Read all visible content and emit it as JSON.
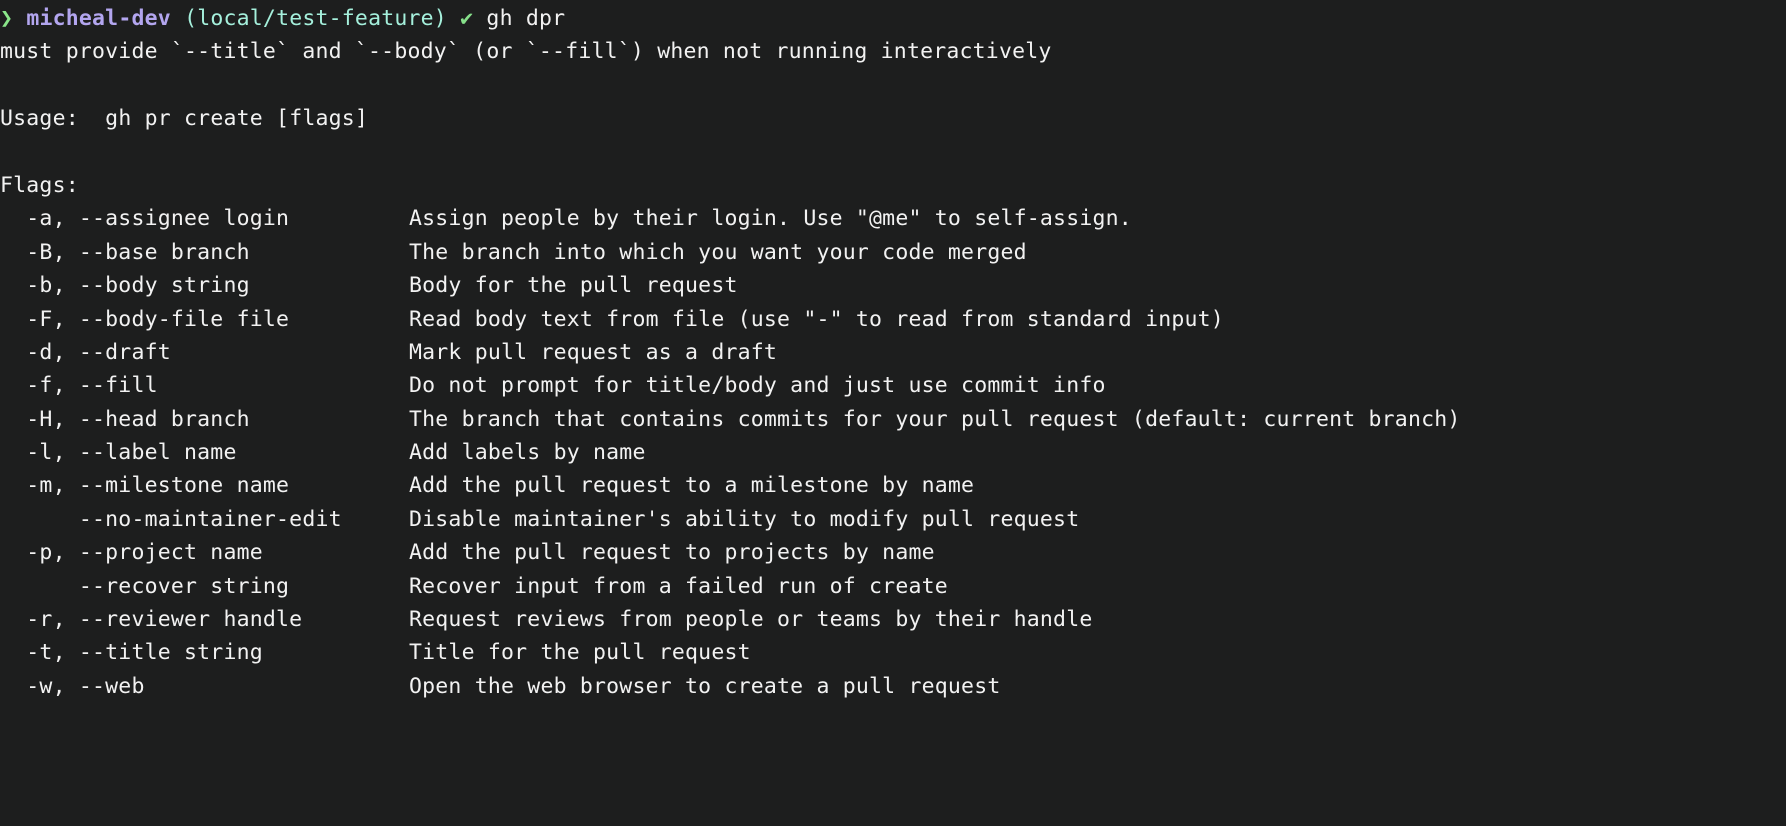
{
  "terminal": {
    "background_color": "#1d1e1e",
    "foreground_color": "#f2f2f2",
    "prompt": {
      "symbol": "❯",
      "symbol_color": "#8ae68a",
      "user": "micheal-dev",
      "user_color": "#b3a6ef",
      "branch": "(local/test-feature)",
      "branch_color": "#a5f0dc",
      "status_check": "✔",
      "status_check_color": "#86e08a",
      "command": "gh dpr"
    },
    "error_line": "must provide `--title` and `--body` (or `--fill`) when not running interactively",
    "usage_label": "Usage:",
    "usage_value": "gh pr create [flags]",
    "flags_label": "Flags:",
    "flags": [
      {
        "names": "  -a, --assignee login",
        "description": "Assign people by their login. Use \"@me\" to self-assign."
      },
      {
        "names": "  -B, --base branch",
        "description": "The branch into which you want your code merged"
      },
      {
        "names": "  -b, --body string",
        "description": "Body for the pull request"
      },
      {
        "names": "  -F, --body-file file",
        "description": "Read body text from file (use \"-\" to read from standard input)"
      },
      {
        "names": "  -d, --draft",
        "description": "Mark pull request as a draft"
      },
      {
        "names": "  -f, --fill",
        "description": "Do not prompt for title/body and just use commit info"
      },
      {
        "names": "  -H, --head branch",
        "description": "The branch that contains commits for your pull request (default: current branch)"
      },
      {
        "names": "  -l, --label name",
        "description": "Add labels by name"
      },
      {
        "names": "  -m, --milestone name",
        "description": "Add the pull request to a milestone by name"
      },
      {
        "names": "      --no-maintainer-edit",
        "description": "Disable maintainer's ability to modify pull request"
      },
      {
        "names": "  -p, --project name",
        "description": "Add the pull request to projects by name"
      },
      {
        "names": "      --recover string",
        "description": "Recover input from a failed run of create"
      },
      {
        "names": "  -r, --reviewer handle",
        "description": "Request reviews from people or teams by their handle"
      },
      {
        "names": "  -t, --title string",
        "description": "Title for the pull request"
      },
      {
        "names": "  -w, --web",
        "description": "Open the web browser to create a pull request"
      }
    ]
  }
}
